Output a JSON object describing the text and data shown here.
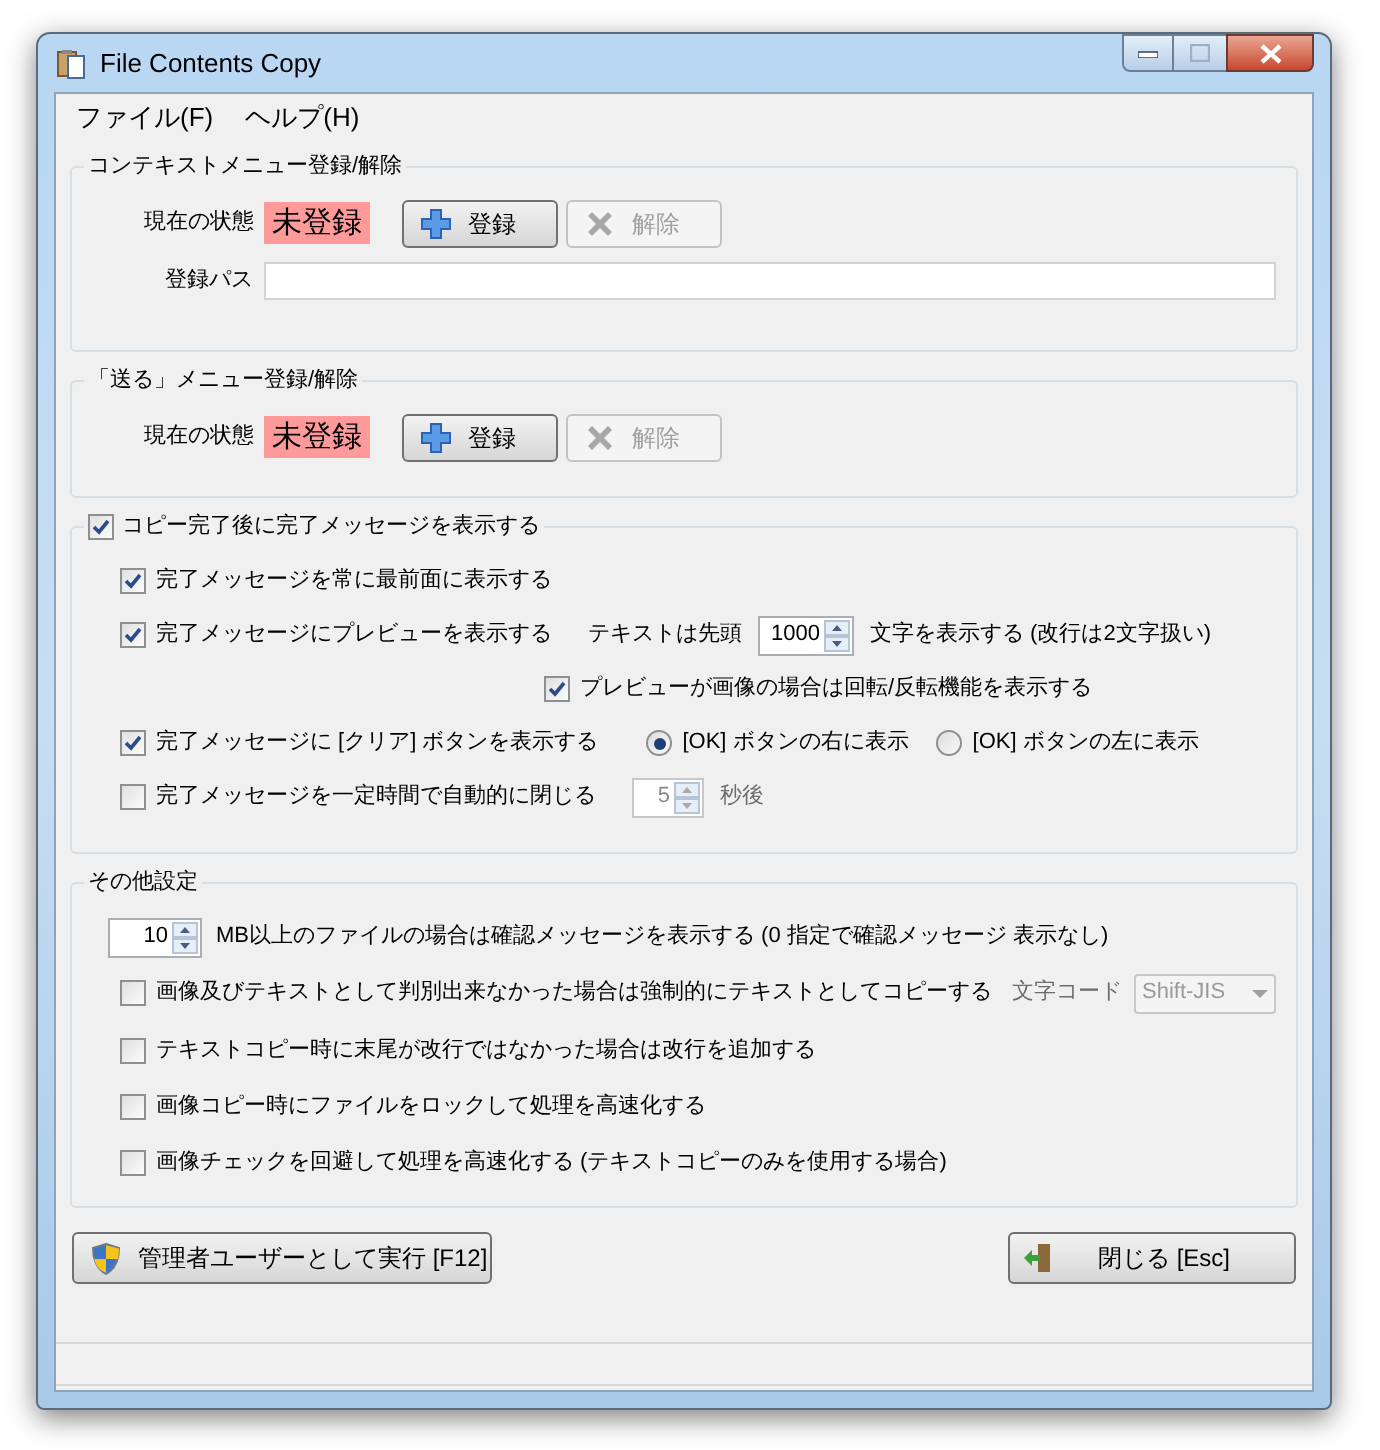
{
  "window": {
    "title": "File Contents Copy"
  },
  "menu": [
    {
      "label": "ファイル(F)"
    },
    {
      "label": "ヘルプ(H)"
    }
  ],
  "context_menu_group": {
    "title": "コンテキストメニュー登録/解除",
    "status_label": "現在の状態",
    "status": "未登録",
    "register_button": {
      "label": "登録",
      "disabled": false
    },
    "unregister_button": {
      "label": "解除",
      "disabled": true
    },
    "path_label": "登録パス"
  },
  "send_to_group": {
    "title": "「送る」メニュー登録/解除",
    "status_label": "現在の状態",
    "status": "未登録",
    "register_button": {
      "label": "登録",
      "disabled": false
    },
    "unregister_button": {
      "label": "解除",
      "disabled": true
    }
  },
  "completion_group": {
    "label": "コピー完了後に完了メッセージを表示する",
    "checked": true,
    "always_on_top": {
      "label": "完了メッセージを常に最前面に表示する",
      "checked": true
    },
    "preview": {
      "label": "完了メッセージにプレビューを表示する",
      "checked": true,
      "prefix": "テキストは先頭",
      "count": "1000",
      "suffix": "文字を表示する (改行は2文字扱い)"
    },
    "rotate": {
      "label": "プレビューが画像の場合は回転/反転機能を表示する",
      "checked": true
    },
    "clear_button": {
      "label": "完了メッセージに [クリア] ボタンを表示する",
      "checked": true,
      "positions": [
        {
          "label": "[OK] ボタンの右に表示",
          "selected": true
        },
        {
          "label": "[OK] ボタンの左に表示",
          "selected": false
        }
      ]
    },
    "auto_close": {
      "label": "完了メッセージを一定時間で自動的に閉じる",
      "checked": false,
      "seconds": "5",
      "unit": "秒後"
    }
  },
  "other_group": {
    "title": "その他設定",
    "size_threshold": {
      "value": "10",
      "label": "MB以上のファイルの場合は確認メッセージを表示する (0 指定で確認メッセージ 表示なし)"
    },
    "force_text": {
      "label": "画像及びテキストとして判別出来なかった場合は強制的にテキストとしてコピーする",
      "checked": false,
      "encoding_label": "文字コード",
      "encoding": "Shift-JIS"
    },
    "options": [
      {
        "label": "テキストコピー時に末尾が改行ではなかった場合は改行を追加する",
        "checked": false
      },
      {
        "label": "画像コピー時にファイルをロックして処理を高速化する",
        "checked": false
      },
      {
        "label": "画像チェックを回避して処理を高速化する (テキストコピーのみを使用する場合)",
        "checked": false
      }
    ]
  },
  "buttons": {
    "admin": "管理者ユーザーとして実行 [F12]",
    "close": "閉じる [Esc]"
  }
}
